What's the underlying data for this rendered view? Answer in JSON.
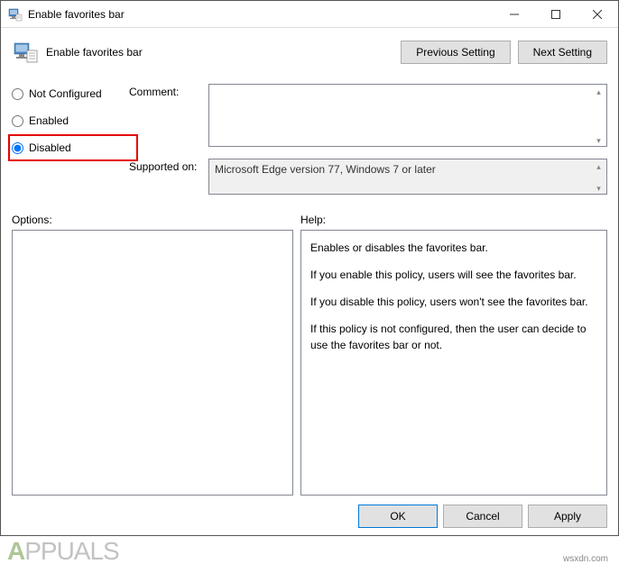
{
  "window": {
    "title": "Enable favorites bar"
  },
  "header": {
    "title": "Enable favorites bar",
    "prev_button": "Previous Setting",
    "next_button": "Next Setting"
  },
  "radios": {
    "not_configured": "Not Configured",
    "enabled": "Enabled",
    "disabled": "Disabled",
    "selected": "disabled"
  },
  "fields": {
    "comment_label": "Comment:",
    "comment_value": "",
    "supported_label": "Supported on:",
    "supported_value": "Microsoft Edge version 77, Windows 7 or later"
  },
  "panels": {
    "options_label": "Options:",
    "help_label": "Help:",
    "help_p1": "Enables or disables the favorites bar.",
    "help_p2": "If you enable this policy, users will see the favorites bar.",
    "help_p3": "If you disable this policy, users won't see the favorites bar.",
    "help_p4": "If this policy is not configured, then the user can decide to use the favorites bar or not."
  },
  "footer": {
    "ok": "OK",
    "cancel": "Cancel",
    "apply": "Apply"
  },
  "watermark": "wsxdn.com",
  "logo_text": "PPUALS"
}
